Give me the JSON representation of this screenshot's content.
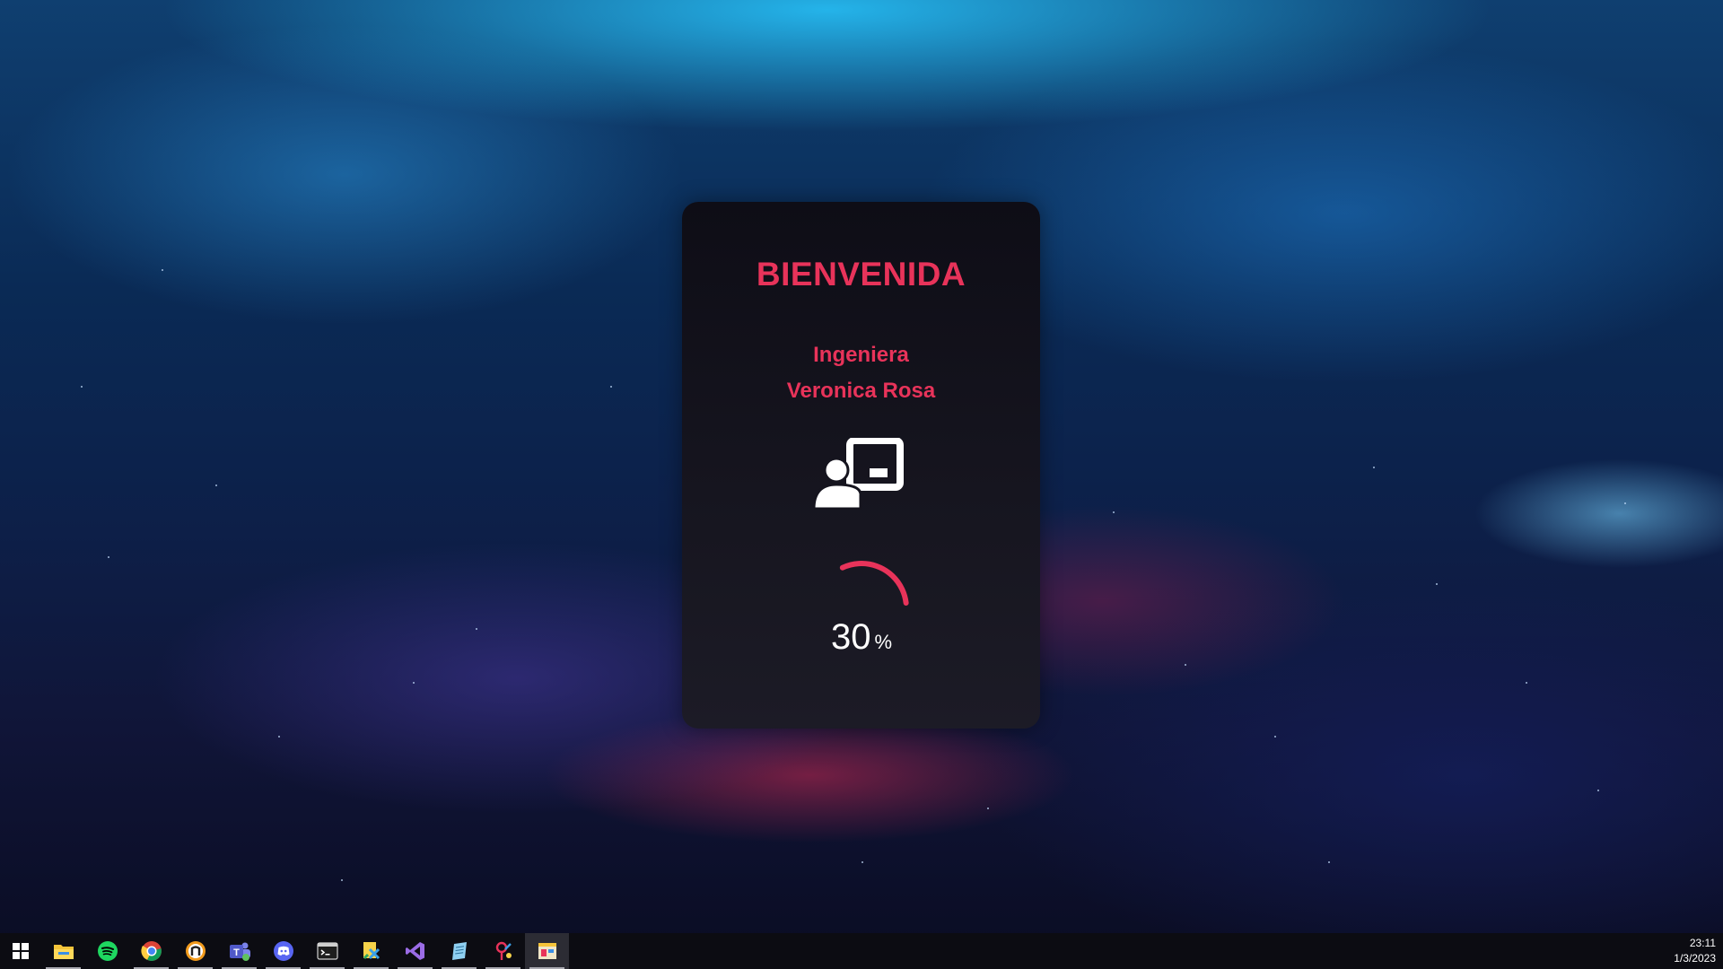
{
  "welcome_card": {
    "title": "BIENVENIDA",
    "role": "Ingeniera",
    "name": "Veronica Rosa",
    "icon": "teacher-presentation-icon",
    "progress_value": "30",
    "progress_unit": "%",
    "progress_fraction": 0.3
  },
  "colors": {
    "accent": "#e8335a",
    "card_bg": "#16151f",
    "text_white": "#ffffff",
    "taskbar_bg": "#0c0c12"
  },
  "taskbar": {
    "start_icon": "windows-logo-icon",
    "apps": [
      {
        "icon": "file-explorer-icon"
      },
      {
        "icon": "spotify-icon"
      },
      {
        "icon": "chrome-icon"
      },
      {
        "icon": "browser-n-icon"
      },
      {
        "icon": "teams-icon"
      },
      {
        "icon": "discord-icon"
      },
      {
        "icon": "terminal-icon"
      },
      {
        "icon": "code-editor-icon"
      },
      {
        "icon": "visual-studio-icon"
      },
      {
        "icon": "notepad-icon"
      },
      {
        "icon": "paint-tool-icon"
      },
      {
        "icon": "app-window-icon"
      }
    ],
    "clock_time": "23:11",
    "clock_date": "1/3/2023"
  }
}
